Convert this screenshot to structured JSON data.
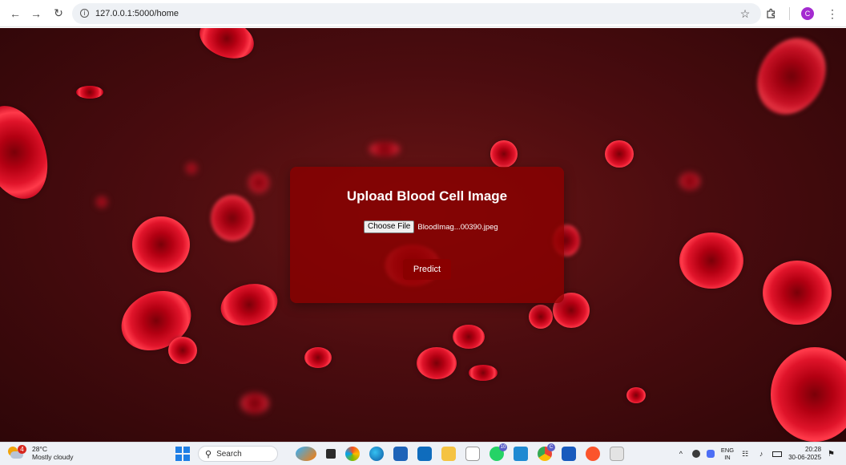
{
  "browser": {
    "url": "127.0.0.1:5000/home",
    "profile_initial": "C"
  },
  "page": {
    "title": "Upload Blood Cell Image",
    "choose_file_label": "Choose File",
    "file_name": "BloodImag...00390.jpeg",
    "predict_label": "Predict",
    "colors": {
      "panel": "#8c0000",
      "button": "#8a0000"
    }
  },
  "taskbar": {
    "weather_temp": "28°C",
    "weather_desc": "Mostly cloudy",
    "weather_alert_count": "4",
    "search_label": "Search",
    "lang_primary": "ENG",
    "lang_secondary": "IN",
    "time": "20:28",
    "date": "30-06-2025",
    "apps": [
      "file-explorer-icon",
      "copilot-icon",
      "edge-icon",
      "store-icon",
      "outlook-icon",
      "folder-icon",
      "notepad-icon",
      "whatsapp-icon",
      "vscode-icon",
      "chrome-icon",
      "word-icon",
      "brave-icon",
      "snipping-icon"
    ]
  }
}
